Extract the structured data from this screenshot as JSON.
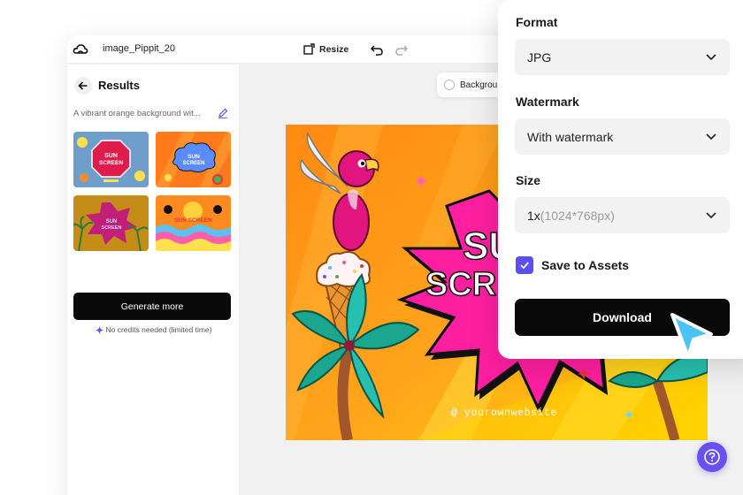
{
  "app": {
    "filename": "image_Pippit_20",
    "resize_label": "Resize"
  },
  "sidebar": {
    "title": "Results",
    "prompt": "A vibrant orange background wit...",
    "thumbnails": [
      {
        "text": "SUN SCREEN",
        "variant": "magenta-octagon"
      },
      {
        "text": "SUN SCREEN",
        "variant": "orange-cloud"
      },
      {
        "text": "SUN SCREEN",
        "variant": "olive-burst"
      },
      {
        "text": "SUN SCREEN",
        "variant": "sunset-waves"
      }
    ],
    "generate_label": "Generate more",
    "credits_text": "No credits needed (limited time)"
  },
  "canvas": {
    "background_chip": "Background",
    "poster": {
      "headline_line1": "SU",
      "headline_line2": "SCRE",
      "website": "@ yourownwebsite"
    }
  },
  "download_panel": {
    "format_label": "Format",
    "format_value": "JPG",
    "watermark_label": "Watermark",
    "watermark_value": "With watermark",
    "size_label": "Size",
    "size_value": "1x",
    "size_detail": "(1024*768px)",
    "save_to_assets_label": "Save to Assets",
    "save_to_assets_checked": true,
    "download_label": "Download"
  },
  "colors": {
    "accent": "#5b4ff0",
    "help_button": "#6a4ff1",
    "cursor": "#4cc3f5",
    "primary_button": "#0a0a0a"
  },
  "icons": [
    "cloud-logo-icon",
    "resize-icon",
    "undo-icon",
    "redo-icon",
    "back-arrow-icon",
    "edit-pencil-icon",
    "sparkle-icon",
    "chevron-down-icon",
    "checkmark-icon",
    "help-icon",
    "pointer-cursor-icon"
  ]
}
